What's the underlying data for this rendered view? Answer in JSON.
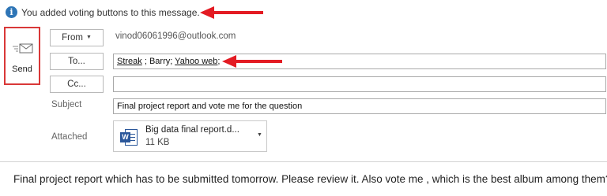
{
  "info_bar": {
    "icon": "info-icon",
    "message": "You added voting buttons to this message."
  },
  "send": {
    "icon": "send-envelope-icon",
    "label": "Send"
  },
  "header": {
    "from_label": "From",
    "from_value": "vinod06061996@outlook.com",
    "to_label": "To...",
    "to_recipients": [
      "Streak",
      "Barry",
      "Yahoo web"
    ],
    "cc_label": "Cc...",
    "cc_value": "",
    "subject_label": "Subject",
    "subject_value": "Final project report and vote me for the question",
    "attached_label": "Attached"
  },
  "attachment": {
    "icon": "word-document-icon",
    "name": "Big data final report.d...",
    "size": "11 KB"
  },
  "body": {
    "text": "Final project report which has to be submitted tomorrow. Please review it. Also vote me , which is the best album among them?"
  },
  "annotation_color": "#e31b23"
}
